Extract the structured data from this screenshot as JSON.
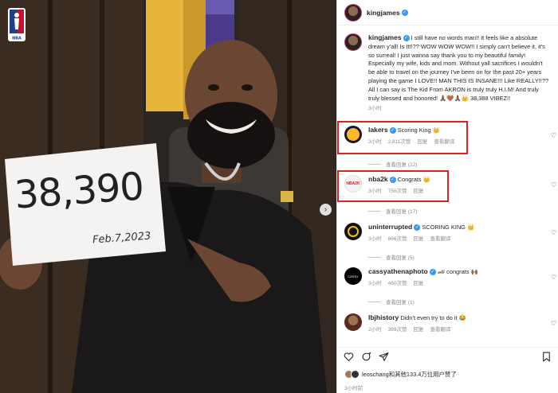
{
  "photo": {
    "sign_number": "38,390",
    "sign_date": "Feb.7,2023",
    "logo_name": "nba-logo",
    "carousel_next": "›"
  },
  "header": {
    "username": "kingjames",
    "verified": "✓"
  },
  "caption": {
    "username": "kingjames",
    "text": "I still have no words man!! It feels like a absolute dream y'all! Is It!!?? WOW WOW WOW!! I simply can't believe it, it's so surreal! I just wanna say thank you to my beautiful family! Especially my wife, kids and mom. Without yall sacrifices I wouldn't be able to travel on the journey I've been on for the past 20+ years playing the game I LOVE!! MAN THIS IS INSANE!!! Like REALLY!!?? All I can say is The Kid From AKRON is truly truly H.I.M! And truly truly blessed and honored! 🙏🏾🤎🙏🏾👑 38,388 VIBEZ!!",
    "time": "3小时"
  },
  "comments": [
    {
      "username": "lakers",
      "verified": true,
      "text": "Scoring King 👑",
      "time": "3小时",
      "likes": "2,811次赞",
      "reply": "回复",
      "translate": "查看翻译",
      "view_replies": "查看回复 (22)",
      "highlighted": true
    },
    {
      "username": "nba2k",
      "verified": true,
      "text": "Congrats 👑",
      "time": "3小时",
      "likes": "756次赞",
      "reply": "回复",
      "translate": "",
      "view_replies": "查看回复 (17)",
      "highlighted": true
    },
    {
      "username": "uninterrupted",
      "verified": true,
      "text": "SCORING KING 👑",
      "time": "3小时",
      "likes": "866次赞",
      "reply": "回复",
      "translate": "查看翻译",
      "view_replies": "查看回复 (5)",
      "highlighted": false
    },
    {
      "username": "cassyathenaphoto",
      "verified": true,
      "text": "🏎 congrats 🙌🏾",
      "time": "3小时",
      "likes": "460次赞",
      "reply": "回复",
      "translate": "",
      "view_replies": "查看回复 (1)",
      "highlighted": false
    },
    {
      "username": "lbjhistory",
      "verified": false,
      "text": "Didn't even try to do it 😂",
      "time": "2小时",
      "likes": "389次赞",
      "reply": "回复",
      "translate": "查看翻译",
      "view_replies": "",
      "highlighted": false
    }
  ],
  "actions": {
    "liked_by": "leoschang和其他133.4万位用户赞了",
    "time": "3小时前"
  },
  "colors": {
    "verified": "#3897f0",
    "highlight": "#e02020",
    "meta_text": "#8e8e8e"
  }
}
